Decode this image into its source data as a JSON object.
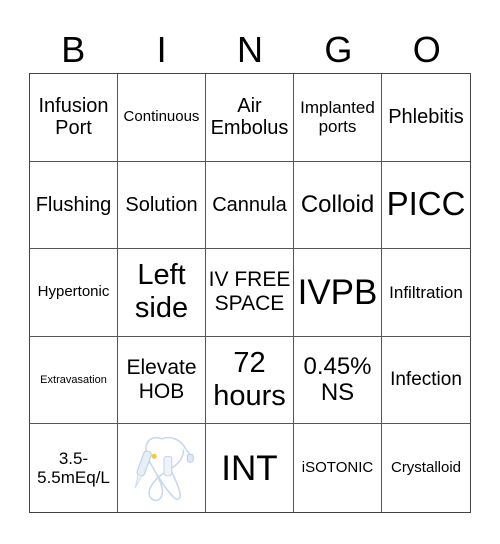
{
  "header": {
    "letters": [
      "B",
      "I",
      "N",
      "G",
      "O"
    ]
  },
  "cells": [
    {
      "text": "Infusion Port"
    },
    {
      "text": "Continuous"
    },
    {
      "text": "Air Embolus"
    },
    {
      "text": "Implanted ports"
    },
    {
      "text": "Phlebitis"
    },
    {
      "text": "Flushing"
    },
    {
      "text": "Solution"
    },
    {
      "text": "Cannula"
    },
    {
      "text": "Colloid"
    },
    {
      "text": "PICC"
    },
    {
      "text": "Hypertonic"
    },
    {
      "text": "Left side"
    },
    {
      "text": "IV FREE SPACE"
    },
    {
      "text": "IVPB"
    },
    {
      "text": "Infiltration"
    },
    {
      "text": "Extravasation"
    },
    {
      "text": "Elevate HOB"
    },
    {
      "text": "72 hours"
    },
    {
      "text": "0.45% NS"
    },
    {
      "text": "Infection"
    },
    {
      "text": "3.5-5.5mEq/L"
    },
    {
      "image": "iv-tubing-set-image"
    },
    {
      "text": "INT"
    },
    {
      "text": "iSOTONIC"
    },
    {
      "text": "Crystalloid"
    }
  ]
}
